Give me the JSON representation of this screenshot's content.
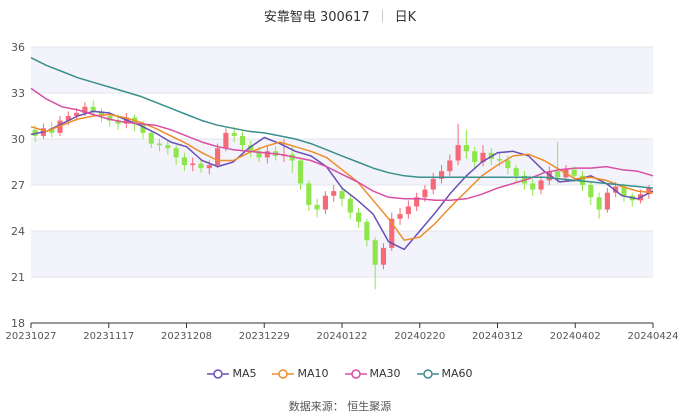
{
  "header": {
    "stock": "安靠智电 300617",
    "period": "日K"
  },
  "footer": {
    "source": "数据来源： 恒生聚源"
  },
  "chart_data": {
    "type": "candlestick",
    "ylim": [
      18,
      36
    ],
    "yticks": [
      "18",
      "21",
      "24",
      "27",
      "30",
      "33",
      "36"
    ],
    "xticks": [
      "20231027",
      "20231117",
      "20231208",
      "20231229",
      "20240122",
      "20240220",
      "20240312",
      "20240402",
      "20240424"
    ],
    "grid": "horizontal",
    "legend_position": "bottom",
    "colors": {
      "up": "#f46b77",
      "down": "#8ee64c"
    },
    "series": [
      {
        "name": "MA5",
        "color": "#6a4fb5",
        "values": [
          30.3,
          30.5,
          31.0,
          31.5,
          31.8,
          31.7,
          31.3,
          30.9,
          30.4,
          29.8,
          29.5,
          28.6,
          28.2,
          28.5,
          29.4,
          30.1,
          29.7,
          29.2,
          28.9,
          28.2,
          26.8,
          26.0,
          25.1,
          23.3,
          22.8,
          24.0,
          25.2,
          26.5,
          27.6,
          28.5,
          29.1,
          29.2,
          28.9,
          27.9,
          27.2,
          27.3,
          27.6,
          27.1,
          26.3,
          26.1,
          26.6
        ]
      },
      {
        "name": "MA10",
        "color": "#ef8c2b",
        "values": [
          30.8,
          30.5,
          30.9,
          31.3,
          31.5,
          31.6,
          31.4,
          31.1,
          30.7,
          30.2,
          29.7,
          29.1,
          28.6,
          28.6,
          29.1,
          29.5,
          29.8,
          29.5,
          29.2,
          28.8,
          28.0,
          27.2,
          26.0,
          24.8,
          23.4,
          23.6,
          24.5,
          25.6,
          26.6,
          27.6,
          28.3,
          28.9,
          29.0,
          28.6,
          28.0,
          27.4,
          27.5,
          27.3,
          26.9,
          26.6,
          26.5
        ]
      },
      {
        "name": "MA30",
        "color": "#d94fa2",
        "values": [
          33.3,
          32.6,
          32.1,
          31.9,
          31.6,
          31.3,
          31.1,
          31.0,
          30.9,
          30.6,
          30.2,
          29.8,
          29.5,
          29.3,
          29.2,
          29.1,
          29.0,
          28.8,
          28.6,
          28.2,
          27.7,
          27.2,
          26.6,
          26.2,
          26.1,
          26.1,
          26.0,
          26.0,
          26.1,
          26.4,
          26.8,
          27.1,
          27.4,
          27.8,
          28.0,
          28.1,
          28.1,
          28.2,
          28.0,
          27.9,
          27.6
        ]
      },
      {
        "name": "MA60",
        "color": "#3b8f8c",
        "values": [
          35.3,
          34.8,
          34.4,
          34.0,
          33.7,
          33.4,
          33.1,
          32.8,
          32.4,
          32.0,
          31.6,
          31.2,
          30.9,
          30.7,
          30.5,
          30.4,
          30.2,
          30.0,
          29.7,
          29.3,
          28.9,
          28.5,
          28.1,
          27.8,
          27.6,
          27.5,
          27.5,
          27.5,
          27.5,
          27.5,
          27.5,
          27.5,
          27.5,
          27.5,
          27.4,
          27.3,
          27.2,
          27.1,
          27.0,
          26.9,
          26.8
        ]
      }
    ],
    "candles_ohlc": [
      [
        30.6,
        30.2,
        30.9,
        29.8
      ],
      [
        30.2,
        30.7,
        31.0,
        30.0
      ],
      [
        30.7,
        30.4,
        31.1,
        30.1
      ],
      [
        30.4,
        31.2,
        31.5,
        30.2
      ],
      [
        31.2,
        31.5,
        31.8,
        30.9
      ],
      [
        31.5,
        31.7,
        32.0,
        31.2
      ],
      [
        31.7,
        32.1,
        32.4,
        31.5
      ],
      [
        32.1,
        31.8,
        32.5,
        31.5
      ],
      [
        31.8,
        31.5,
        32.0,
        31.1
      ],
      [
        31.5,
        31.2,
        31.8,
        30.8
      ],
      [
        31.2,
        31.0,
        31.6,
        30.6
      ],
      [
        31.0,
        31.4,
        31.7,
        30.7
      ],
      [
        31.4,
        31.0,
        31.6,
        30.5
      ],
      [
        31.0,
        30.4,
        31.2,
        30.0
      ],
      [
        30.4,
        29.7,
        30.6,
        29.4
      ],
      [
        29.7,
        29.6,
        30.0,
        29.2
      ],
      [
        29.6,
        29.4,
        29.9,
        29.0
      ],
      [
        29.4,
        28.8,
        29.6,
        28.3
      ],
      [
        28.8,
        28.3,
        29.1,
        27.9
      ],
      [
        28.3,
        28.4,
        28.8,
        27.9
      ],
      [
        28.4,
        28.1,
        28.7,
        27.8
      ],
      [
        28.1,
        28.3,
        28.6,
        27.7
      ],
      [
        28.3,
        29.4,
        29.7,
        28.1
      ],
      [
        29.4,
        30.4,
        30.7,
        29.2
      ],
      [
        30.4,
        30.2,
        30.8,
        29.8
      ],
      [
        30.2,
        29.6,
        30.5,
        29.2
      ],
      [
        29.6,
        29.2,
        29.9,
        28.8
      ],
      [
        29.2,
        28.8,
        29.5,
        28.5
      ],
      [
        28.8,
        29.2,
        29.6,
        28.4
      ],
      [
        29.2,
        28.9,
        29.5,
        28.6
      ],
      [
        28.9,
        29.0,
        30.0,
        28.5
      ],
      [
        29.0,
        28.6,
        29.5,
        27.8
      ],
      [
        28.6,
        27.1,
        28.8,
        26.7
      ],
      [
        27.1,
        25.7,
        27.3,
        25.3
      ],
      [
        25.7,
        25.4,
        26.1,
        24.9
      ],
      [
        25.4,
        26.3,
        26.6,
        25.1
      ],
      [
        26.3,
        26.6,
        27.0,
        25.9
      ],
      [
        26.6,
        26.1,
        26.9,
        25.6
      ],
      [
        26.1,
        25.2,
        26.4,
        24.8
      ],
      [
        25.2,
        24.6,
        25.5,
        24.2
      ],
      [
        24.6,
        23.4,
        24.8,
        23.0
      ],
      [
        23.4,
        21.8,
        23.6,
        20.2
      ],
      [
        21.8,
        22.9,
        23.2,
        21.5
      ],
      [
        22.9,
        24.8,
        25.2,
        22.7
      ],
      [
        24.8,
        25.1,
        25.5,
        24.4
      ],
      [
        25.1,
        25.6,
        26.0,
        24.8
      ],
      [
        25.6,
        26.2,
        26.5,
        25.3
      ],
      [
        26.2,
        26.7,
        27.0,
        25.9
      ],
      [
        26.7,
        27.4,
        27.8,
        26.4
      ],
      [
        27.4,
        27.9,
        28.3,
        27.1
      ],
      [
        27.9,
        28.6,
        29.0,
        27.6
      ],
      [
        28.6,
        29.6,
        31.0,
        28.3
      ],
      [
        29.6,
        29.2,
        30.6,
        28.7
      ],
      [
        29.2,
        28.5,
        29.5,
        28.1
      ],
      [
        28.5,
        29.1,
        29.6,
        28.2
      ],
      [
        29.1,
        28.7,
        29.4,
        28.3
      ],
      [
        28.7,
        28.6,
        29.2,
        28.2
      ],
      [
        28.6,
        28.1,
        28.9,
        27.7
      ],
      [
        28.1,
        27.6,
        28.3,
        27.2
      ],
      [
        27.6,
        27.1,
        27.9,
        26.7
      ],
      [
        27.1,
        26.7,
        27.4,
        26.3
      ],
      [
        26.7,
        27.3,
        27.6,
        26.4
      ],
      [
        27.3,
        27.9,
        28.2,
        27.0
      ],
      [
        27.9,
        27.5,
        29.8,
        27.1
      ],
      [
        27.5,
        28.0,
        28.3,
        27.2
      ],
      [
        28.0,
        27.6,
        28.2,
        27.2
      ],
      [
        27.6,
        27.0,
        27.9,
        26.6
      ],
      [
        27.0,
        26.2,
        27.2,
        25.7
      ],
      [
        26.2,
        25.4,
        26.5,
        24.8
      ],
      [
        25.4,
        26.5,
        26.8,
        25.2
      ],
      [
        26.5,
        26.9,
        27.2,
        26.2
      ],
      [
        26.9,
        26.3,
        27.1,
        25.9
      ],
      [
        26.3,
        26.0,
        26.5,
        25.6
      ],
      [
        26.0,
        26.4,
        26.7,
        25.8
      ],
      [
        26.4,
        26.8,
        27.0,
        26.1
      ]
    ]
  }
}
